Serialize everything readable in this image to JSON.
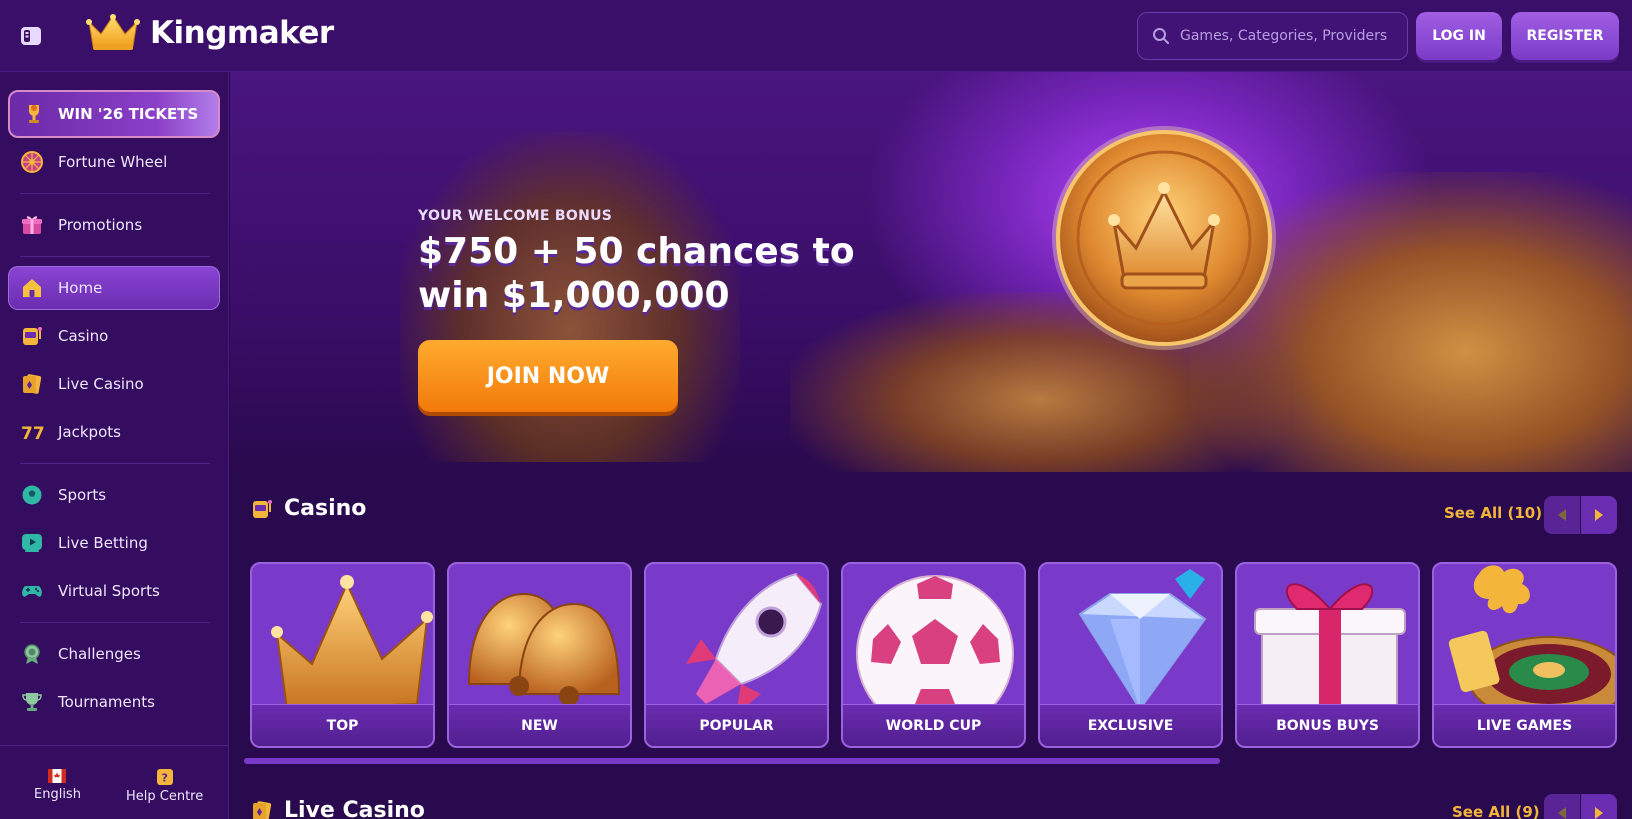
{
  "header": {
    "brand": "Kingmaker",
    "search_placeholder": "Games, Categories, Providers",
    "login_label": "LOG IN",
    "register_label": "REGISTER"
  },
  "sidebar": {
    "promo": {
      "label": "WIN '26 TICKETS",
      "icon": "trophy-icon"
    },
    "items": [
      {
        "label": "Fortune Wheel",
        "icon": "fortune-wheel-icon"
      },
      {
        "label": "Promotions",
        "icon": "gift-icon"
      },
      {
        "label": "Home",
        "icon": "home-icon"
      },
      {
        "label": "Casino",
        "icon": "slot-machine-icon"
      },
      {
        "label": "Live Casino",
        "icon": "cards-icon"
      },
      {
        "label": "Jackpots",
        "icon": "sevens-icon"
      },
      {
        "label": "Sports",
        "icon": "football-icon"
      },
      {
        "label": "Live Betting",
        "icon": "play-screen-icon"
      },
      {
        "label": "Virtual Sports",
        "icon": "gamepad-icon"
      },
      {
        "label": "Challenges",
        "icon": "badge-icon"
      },
      {
        "label": "Tournaments",
        "icon": "cup-icon"
      }
    ],
    "footer": {
      "language_label": "English",
      "help_label": "Help Centre"
    }
  },
  "hero": {
    "kicker": "YOUR WELCOME BONUS",
    "title": "$750 + 50 chances to win $1,000,000",
    "cta_label": "JOIN NOW"
  },
  "casino": {
    "title": "Casino",
    "see_all": "See All (10)",
    "categories": [
      {
        "label": "TOP",
        "icon": "crown-icon"
      },
      {
        "label": "NEW",
        "icon": "bells-icon"
      },
      {
        "label": "POPULAR",
        "icon": "rocket-icon"
      },
      {
        "label": "WORLD CUP",
        "icon": "soccer-ball-icon"
      },
      {
        "label": "EXCLUSIVE",
        "icon": "diamond-icon"
      },
      {
        "label": "BONUS BUYS",
        "icon": "gift-box-icon"
      },
      {
        "label": "LIVE GAMES",
        "icon": "roulette-icon"
      }
    ]
  },
  "live_casino": {
    "title": "Live Casino",
    "see_all": "See All (9)"
  },
  "colors": {
    "background": "#2a0a4e",
    "accent_purple": "#7a3ac9",
    "accent_orange": "#f27a0a",
    "link_gold": "#f4b63a"
  }
}
